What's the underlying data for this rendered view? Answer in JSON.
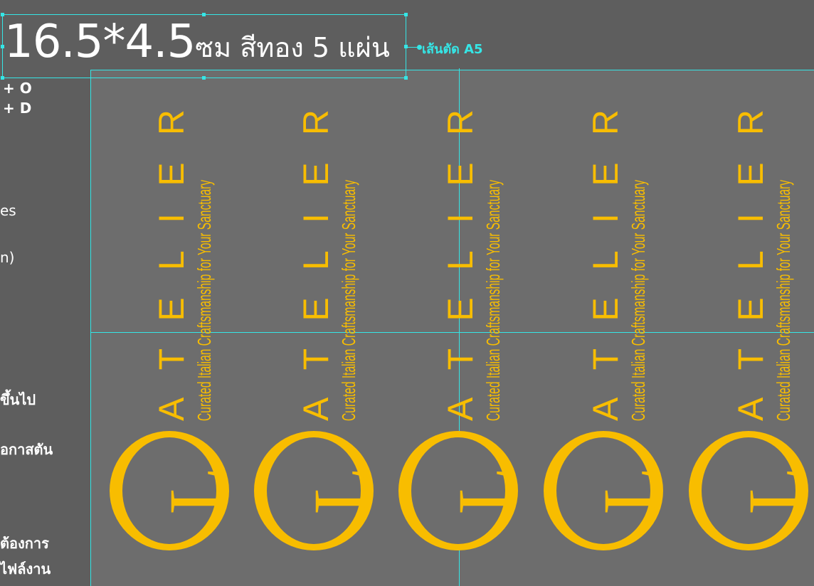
{
  "title": {
    "size_text": "16.5*4.5",
    "details_text": "ซม สีทอง 5 แผ่น",
    "cut_line_label": "เส้นตัด A5"
  },
  "sidebar": {
    "lines": [
      "+ O",
      "+ D",
      "es",
      "n)",
      "ขึ้นไป",
      "อกาสตัน",
      "ต้องการ",
      "ไฟล์งาน"
    ]
  },
  "label": {
    "brand_letters": [
      "A",
      "T",
      "E",
      "L",
      "I",
      "E",
      "R"
    ],
    "tagline": "Curated Italian Craftsmanship for Your Sanctuary",
    "emblem_letter": "L"
  },
  "colors": {
    "gold": "#f8bd00",
    "guide": "#35e6e6",
    "canvas": "#5e5e5e",
    "artboard": "#6d6d6d"
  }
}
